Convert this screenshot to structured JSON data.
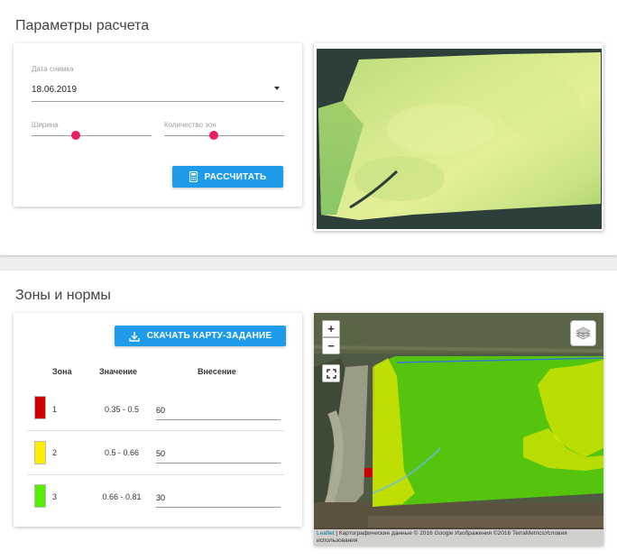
{
  "calc_section": {
    "title": "Параметры расчета",
    "date_field": {
      "label": "Дата снимка",
      "value": "18.06.2019"
    },
    "width_slider": {
      "label": "Ширина",
      "value_fraction": 0.37
    },
    "zones_slider": {
      "label": "Количество зон",
      "value_fraction": 0.41
    },
    "calculate_button": {
      "label": "РАССЧИТАТЬ",
      "icon": "calculator-icon"
    }
  },
  "zones_section": {
    "title": "Зоны и нормы",
    "download_button": {
      "label": "СКАЧАТЬ КАРТУ-ЗАДАНИЕ",
      "icon": "download-icon"
    },
    "table": {
      "headers": [
        "Зона",
        "Значение",
        "Внесение"
      ],
      "rows": [
        {
          "zone": "1",
          "color": "#cc0000",
          "range": "0.35 - 0.5",
          "rate": "60"
        },
        {
          "zone": "2",
          "color": "#ffee00",
          "range": "0.5 - 0.66",
          "rate": "50"
        },
        {
          "zone": "3",
          "color": "#55ee00",
          "range": "0.66 - 0.81",
          "rate": "30"
        }
      ]
    }
  },
  "map": {
    "zoom_in": "+",
    "zoom_out": "−",
    "layers_icon": "layers-icon",
    "fullscreen_icon": "fullscreen-icon",
    "attribution_link": "Leaflet",
    "attribution_text": " | Картографические данные © 2016 Google Изображения ©2016 TerraMetricsУсловия использования"
  },
  "colors": {
    "accent_button": "#1e9be9",
    "slider_thumb": "#e91e63"
  }
}
